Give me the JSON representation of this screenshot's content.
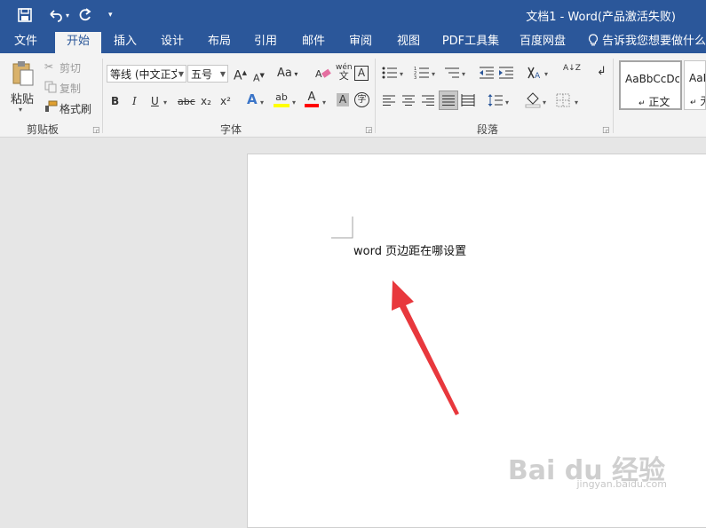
{
  "title_bar": {
    "doc_title": "文档1 - Word(产品激活失败)",
    "qat_dropdown": "▾"
  },
  "tabs": [
    "文件",
    "开始",
    "插入",
    "设计",
    "布局",
    "引用",
    "邮件",
    "审阅",
    "视图",
    "PDF工具集",
    "百度网盘"
  ],
  "tell_me": "告诉我您想要做什么...",
  "clipboard": {
    "paste": "粘贴",
    "cut": "剪切",
    "copy": "复制",
    "format_painter": "格式刷",
    "group_label": "剪贴板"
  },
  "font": {
    "font_name": "等线 (中文正文",
    "font_size": "五号",
    "grow": "A",
    "shrink": "A",
    "change_case": "Aa",
    "phonetic": "wén",
    "phonetic_char": "文",
    "char_border": "A",
    "bold": "B",
    "italic": "I",
    "underline": "U",
    "strikethrough": "abc",
    "subscript": "x₂",
    "superscript": "x²",
    "text_effects": "A",
    "highlight": "ab",
    "font_color": "A",
    "char_shading": "A",
    "enclose": "字",
    "group_label": "字体"
  },
  "paragraph": {
    "sort": "A↓Z",
    "group_label": "段落"
  },
  "styles": {
    "items": [
      {
        "sample": "AaBbCcDc",
        "name": "正文"
      },
      {
        "sample": "AaB",
        "name": "无"
      }
    ],
    "prefix": "↵"
  },
  "document": {
    "text": "word 页边距在哪设置"
  },
  "watermark": {
    "text": "Bai du 经验",
    "url": "jingyan.baidu.com"
  },
  "colors": {
    "brand": "#2b579a",
    "highlight": "#ffff00",
    "font_color": "#ff0000",
    "arrow": "#e8383d"
  }
}
